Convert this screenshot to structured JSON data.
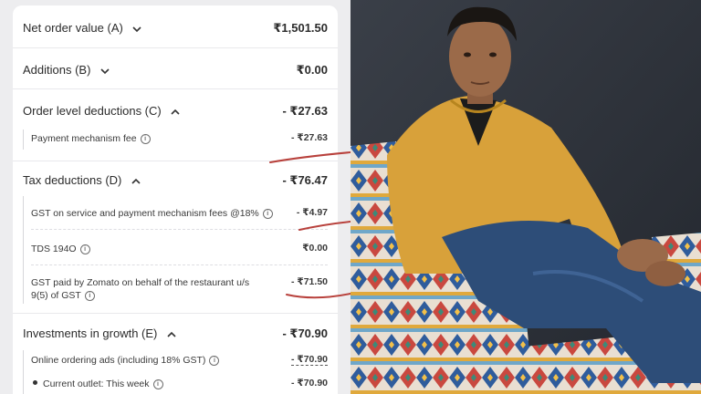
{
  "net_order": {
    "label": "Net order value (A)",
    "value": "₹1,501.50"
  },
  "additions": {
    "label": "Additions (B)",
    "value": "₹0.00"
  },
  "order_deductions": {
    "label": "Order level deductions (C)",
    "value": "- ₹27.63",
    "items": [
      {
        "label": "Payment mechanism fee",
        "value": "- ₹27.63"
      }
    ]
  },
  "tax_deductions": {
    "label": "Tax deductions (D)",
    "value": "- ₹76.47",
    "items": [
      {
        "label": "GST on service and payment mechanism fees @18%",
        "value": "- ₹4.97"
      },
      {
        "label": "TDS 194O",
        "value": "₹0.00"
      },
      {
        "label_line1": "GST paid by Zomato on behalf of the restaurant u/s",
        "label_line2": "9(5) of GST",
        "value": "- ₹71.50"
      }
    ]
  },
  "investments": {
    "label": "Investments in growth (E)",
    "value": "- ₹70.90",
    "items": [
      {
        "label": "Online ordering ads (including 18% GST)",
        "value": "- ₹70.90"
      },
      {
        "label": "Current outlet: This week",
        "value": "- ₹70.90"
      }
    ]
  },
  "icons": {
    "expand": "chevron-down-icon",
    "collapse": "chevron-up-icon",
    "info": "info-icon",
    "bullet": "bullet-icon"
  },
  "colors": {
    "annotation": "#b8413c",
    "card": "#ffffff",
    "background": "#ededef"
  }
}
